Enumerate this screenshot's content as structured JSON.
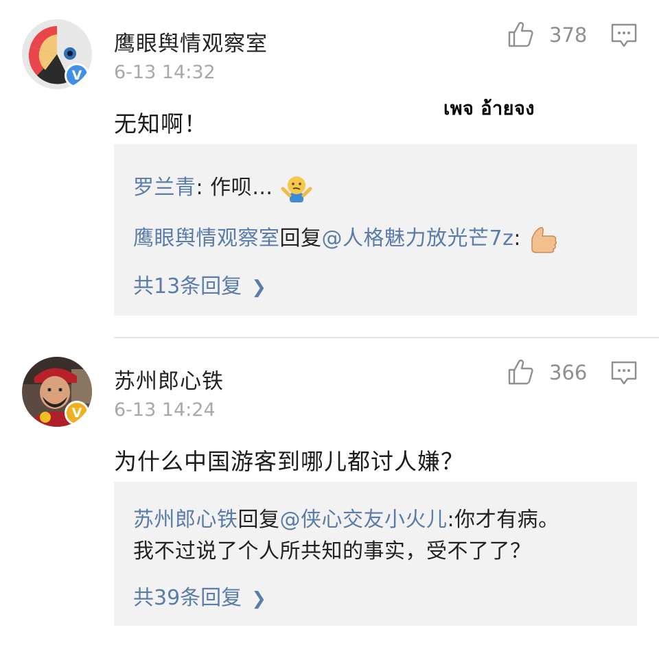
{
  "comments": [
    {
      "username": "鹰眼舆情观察室",
      "timestamp": "6-13 14:32",
      "text": "无知啊！",
      "likes": "378",
      "verified_badge": "V",
      "verified_color": "#3f8ee8",
      "replies": [
        {
          "author": "罗兰青",
          "sep": ": ",
          "text": "作呗…",
          "emoji": "shrug-emoji"
        },
        {
          "author": "鹰眼舆情观察室",
          "action": "回复",
          "mention": "@人格魅力放光芒7z",
          "sep": ":",
          "emoji": "thumbs-up-emoji"
        }
      ],
      "more_replies": "共13条回复"
    },
    {
      "username": "苏州郎心铁",
      "timestamp": "6-13 14:24",
      "text": "为什么中国游客到哪儿都讨人嫌？",
      "likes": "366",
      "verified_badge": "V",
      "verified_color": "#f0b020",
      "replies": [
        {
          "author": "苏州郎心铁",
          "action": "回复",
          "mention": "@侠心交友小火儿",
          "text": ":你才有病。",
          "text2": "我不过说了个人所共知的事实，受不了了？"
        }
      ],
      "more_replies": "共39条回复"
    }
  ],
  "overlay_caption": "เพจ อ้ายจง",
  "colors": {
    "link_blue": "#5a7ca8",
    "reply_background": "#f2f2f2",
    "timestamp_gray": "#a8a8a8",
    "icon_gray": "#8f8f8f"
  }
}
